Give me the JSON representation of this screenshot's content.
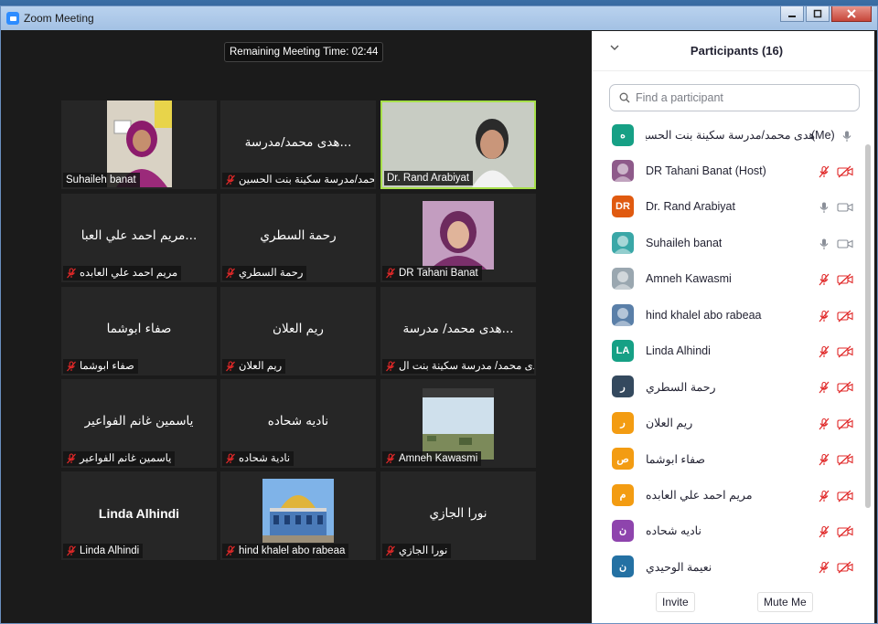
{
  "window": {
    "title": "Zoom Meeting"
  },
  "meeting": {
    "remaining_time": "Remaining Meeting Time: 02:44"
  },
  "tiles": [
    {
      "label": "Suhaileh banat",
      "center": "",
      "photo": "pink-scarf"
    },
    {
      "label": "هدى محمد/مدرسة سكينة بنت الحسين...",
      "center": "هدى محمد/مدرسة...",
      "photo": ""
    },
    {
      "label": "Dr. Rand Arabiyat",
      "center": "",
      "photo": "white-scarf"
    },
    {
      "label": "مريم احمد علي العابده",
      "center": "مريم احمد علي العبا...",
      "photo": ""
    },
    {
      "label": "رحمة السطري",
      "center": "رحمة السطري",
      "photo": ""
    },
    {
      "label": "DR Tahani Banat",
      "center": "",
      "photo": "purple-scarf"
    },
    {
      "label": "صفاء ابوشما",
      "center": "صفاء ابوشما",
      "photo": ""
    },
    {
      "label": "ريم العلان",
      "center": "ريم العلان",
      "photo": ""
    },
    {
      "label": "هدى محمد/ مدرسة سكينة بنت ال...",
      "center": "هدى محمد/ مدرسة...",
      "photo": ""
    },
    {
      "label": "ياسمين غانم الفواعير",
      "center": "ياسمين غانم الفواعير",
      "photo": ""
    },
    {
      "label": "نادية شحاده",
      "center": "ناديه شحاده",
      "photo": ""
    },
    {
      "label": "Amneh Kawasmi",
      "center": "",
      "photo": "landscape"
    },
    {
      "label": "Linda Alhindi",
      "center": "Linda Alhindi",
      "photo": ""
    },
    {
      "label": "hind khalel abo rabeaa",
      "center": "",
      "photo": "dome"
    },
    {
      "label": "نورا الجازي",
      "center": "نورا الجازي",
      "photo": ""
    }
  ],
  "participants": {
    "title": "Participants (16)",
    "search_placeholder": "Find a participant",
    "items": [
      {
        "name": "هدى محمد/مدرسة سكينة بنت الحسين الا...",
        "tag": "(Me)",
        "avatar_text": "ه",
        "avatar_color": "#16a085",
        "mic": "on",
        "cam": ""
      },
      {
        "name": "DR Tahani Banat (Host)",
        "tag": "",
        "avatar_text": "",
        "avatar_color": "#8e5a8a",
        "mic": "muted",
        "cam": "off"
      },
      {
        "name": "Dr. Rand Arabiyat",
        "tag": "",
        "avatar_text": "DR",
        "avatar_color": "#e05a10",
        "mic": "on",
        "cam": "on"
      },
      {
        "name": "Suhaileh banat",
        "tag": "",
        "avatar_text": "",
        "avatar_color": "#3aa7a7",
        "mic": "on",
        "cam": "on"
      },
      {
        "name": "Amneh Kawasmi",
        "tag": "",
        "avatar_text": "",
        "avatar_color": "#9aa7b0",
        "mic": "muted",
        "cam": "off"
      },
      {
        "name": "hind khalel abo rabeaa",
        "tag": "",
        "avatar_text": "",
        "avatar_color": "#5a7fa8",
        "mic": "muted",
        "cam": "off"
      },
      {
        "name": "Linda Alhindi",
        "tag": "",
        "avatar_text": "LA",
        "avatar_color": "#16a085",
        "mic": "muted",
        "cam": "off"
      },
      {
        "name": "رحمة السطري",
        "tag": "",
        "avatar_text": "ر",
        "avatar_color": "#34495e",
        "mic": "muted",
        "cam": "off"
      },
      {
        "name": "ريم العلان",
        "tag": "",
        "avatar_text": "ر",
        "avatar_color": "#f39c12",
        "mic": "muted",
        "cam": "off"
      },
      {
        "name": "صفاء ابوشما",
        "tag": "",
        "avatar_text": "ص",
        "avatar_color": "#f39c12",
        "mic": "muted",
        "cam": "off"
      },
      {
        "name": "مريم احمد علي العابده",
        "tag": "",
        "avatar_text": "م",
        "avatar_color": "#f39c12",
        "mic": "muted",
        "cam": "off"
      },
      {
        "name": "ناديه شحاده",
        "tag": "",
        "avatar_text": "ن",
        "avatar_color": "#8e44ad",
        "mic": "muted",
        "cam": "off"
      },
      {
        "name": "نعيمة الوحيدي",
        "tag": "",
        "avatar_text": "ن",
        "avatar_color": "#2471a3",
        "mic": "muted",
        "cam": "off"
      }
    ],
    "invite_label": "Invite",
    "mute_me_label": "Mute Me"
  },
  "colors": {
    "accent": "#2d8cff",
    "active_speaker": "#a7e04a",
    "muted_red": "#e02828"
  }
}
